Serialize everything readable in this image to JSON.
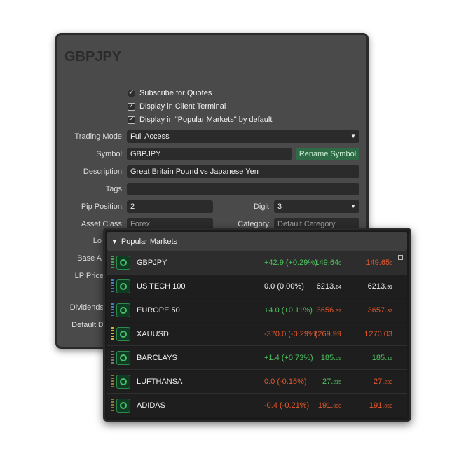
{
  "settings": {
    "title": "GBPJPY",
    "checkboxes": [
      {
        "label": "Subscribe for Quotes",
        "checked": true
      },
      {
        "label": "Display in Client Terminal",
        "checked": true
      },
      {
        "label": "Display in \"Popular Markets\" by default",
        "checked": true
      }
    ],
    "check_mark": "✓",
    "trading_mode": {
      "label": "Trading Mode:",
      "value": "Full Access"
    },
    "symbol": {
      "label": "Symbol:",
      "value": "GBPJPY",
      "rename_label": "Rename Symbol"
    },
    "description": {
      "label": "Description:",
      "value": "Great Britain Pound vs Japanese Yen"
    },
    "tags": {
      "label": "Tags:",
      "value": ""
    },
    "pip_position": {
      "label": "Pip Position:",
      "value": "2"
    },
    "digit": {
      "label": "Digit:",
      "value": "3"
    },
    "asset_class": {
      "label": "Asset Class:",
      "value": "Forex"
    },
    "category": {
      "label": "Category:",
      "value": "Default Category"
    },
    "partial_labels": [
      "Lo",
      "Base A",
      "LP Price",
      "Dividends",
      "Default D"
    ]
  },
  "popular_markets": {
    "title": "Popular Markets",
    "rows": [
      {
        "name": "GBPJPY",
        "change": "+42.9 (+0.29%)",
        "change_dir": "pos",
        "bid_main": "149.64",
        "bid_small": "0",
        "bid_dir": "pos",
        "ask_main": "149.65",
        "ask_small": "0",
        "ask_dir": "neg",
        "grip": "g"
      },
      {
        "name": "US TECH 100",
        "change": "0.0 (0.00%)",
        "change_dir": "neu",
        "bid_main": "6213.",
        "bid_small": "64",
        "bid_dir": "neu",
        "ask_main": "6213.",
        "ask_small": "91",
        "ask_dir": "neu",
        "grip": "b"
      },
      {
        "name": "EUROPE 50",
        "change": "+4.0 (+0.11%)",
        "change_dir": "pos",
        "bid_main": "3656.",
        "bid_small": "32",
        "bid_dir": "neg",
        "ask_main": "3657.",
        "ask_small": "32",
        "ask_dir": "neg",
        "grip": "b"
      },
      {
        "name": "XAUUSD",
        "change": "-370.0 (-0.29%)",
        "change_dir": "neg",
        "bid_main": "1269.99",
        "bid_small": "",
        "bid_dir": "neg",
        "ask_main": "1270.03",
        "ask_small": "",
        "ask_dir": "neg",
        "grip": "y"
      },
      {
        "name": "BARCLAYS",
        "change": "+1.4 (+0.73%)",
        "change_dir": "pos",
        "bid_main": "185.",
        "bid_small": "05",
        "bid_dir": "pos",
        "ask_main": "185.",
        "ask_small": "15",
        "ask_dir": "pos",
        "grip": "n"
      },
      {
        "name": "LUFTHANSA",
        "change": "0.0 (-0.15%)",
        "change_dir": "neg",
        "bid_main": "27.",
        "bid_small": "215",
        "bid_dir": "pos",
        "ask_main": "27.",
        "ask_small": "230",
        "ask_dir": "neg",
        "grip": "o"
      },
      {
        "name": "ADIDAS",
        "change": "-0.4 (-0.21%)",
        "change_dir": "neg",
        "bid_main": "191.",
        "bid_small": "000",
        "bid_dir": "neg",
        "ask_main": "191.",
        "ask_small": "050",
        "ask_dir": "neg",
        "grip": "o"
      }
    ]
  },
  "colors": {
    "positive": "#4ec25f",
    "negative": "#e2572d",
    "accent_green": "#2e6a45"
  }
}
